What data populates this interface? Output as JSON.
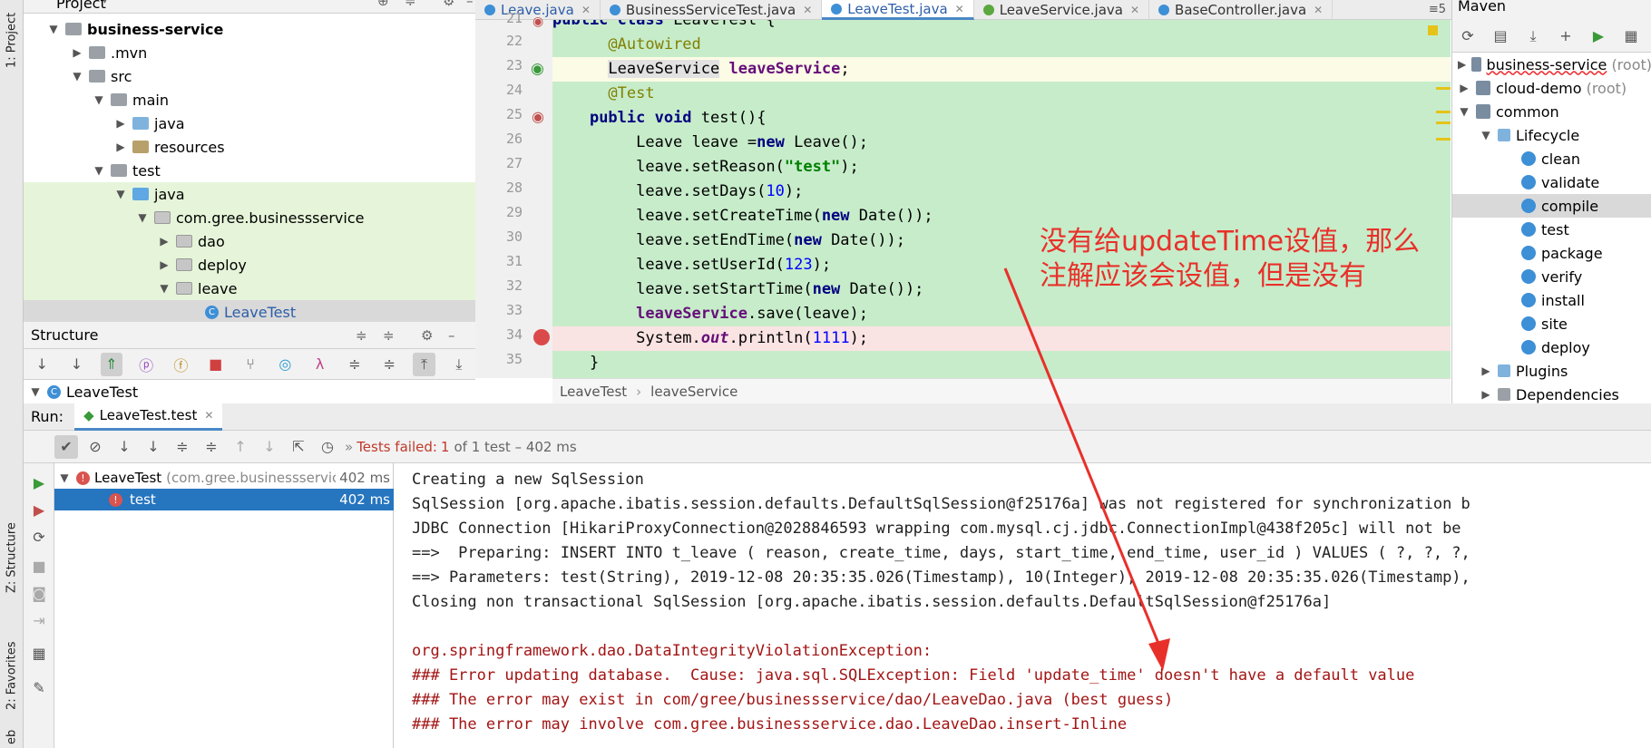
{
  "left_strip": {
    "project_tab": "1: Project",
    "structure_tab": "Z: Structure",
    "favorites_tab": "2: Favorites",
    "web_tab": "eb"
  },
  "project_panel": {
    "title": "Project",
    "tree": [
      {
        "label": "business-service",
        "bold": true
      },
      {
        "label": ".mvn"
      },
      {
        "label": "src"
      },
      {
        "label": "main"
      },
      {
        "label": "java"
      },
      {
        "label": "resources"
      },
      {
        "label": "test"
      },
      {
        "label": "java"
      },
      {
        "label": "com.gree.businessservice"
      },
      {
        "label": "dao"
      },
      {
        "label": "deploy"
      },
      {
        "label": "leave"
      },
      {
        "label": "LeaveTest"
      }
    ]
  },
  "structure_panel": {
    "title": "Structure",
    "root": "LeaveTest"
  },
  "editor": {
    "tabs": [
      {
        "label": "Leave.java",
        "active": false
      },
      {
        "label": "BusinessServiceTest.java",
        "active": false
      },
      {
        "label": "LeaveTest.java",
        "active": true
      },
      {
        "label": "LeaveService.java",
        "active": false
      },
      {
        "label": "BaseController.java",
        "active": false
      }
    ],
    "tab_overflow": "5",
    "line_numbers": [
      "21",
      "22",
      "23",
      "24",
      "25",
      "26",
      "27",
      "28",
      "29",
      "30",
      "31",
      "32",
      "33",
      "34",
      "35"
    ],
    "breadcrumb": [
      "LeaveTest",
      "leaveService"
    ]
  },
  "maven": {
    "title": "Maven",
    "items": [
      {
        "label": "business-service",
        "suffix": "(root)"
      },
      {
        "label": "cloud-demo",
        "suffix": "(root)"
      },
      {
        "label": "common",
        "suffix": ""
      },
      {
        "label": "Lifecycle",
        "suffix": ""
      },
      {
        "label": "clean",
        "suffix": ""
      },
      {
        "label": "validate",
        "suffix": ""
      },
      {
        "label": "compile",
        "suffix": ""
      },
      {
        "label": "test",
        "suffix": ""
      },
      {
        "label": "package",
        "suffix": ""
      },
      {
        "label": "verify",
        "suffix": ""
      },
      {
        "label": "install",
        "suffix": ""
      },
      {
        "label": "site",
        "suffix": ""
      },
      {
        "label": "deploy",
        "suffix": ""
      },
      {
        "label": "Plugins",
        "suffix": ""
      },
      {
        "label": "Dependencies",
        "suffix": ""
      }
    ]
  },
  "run": {
    "label": "Run:",
    "tab": "LeaveTest.test",
    "status_prefix": "Tests failed:",
    "status_count": "1",
    "status_suffix": "of 1 test – 402 ms",
    "tests": [
      {
        "name": "LeaveTest",
        "pkg": "(com.gree.businessservice",
        "time": "402 ms"
      },
      {
        "name": "test",
        "pkg": "",
        "time": "402 ms"
      }
    ],
    "console": [
      {
        "text": "Creating a new SqlSession",
        "err": false
      },
      {
        "text": "SqlSession [org.apache.ibatis.session.defaults.DefaultSqlSession@f25176a] was not registered for synchronization b",
        "err": false
      },
      {
        "text": "JDBC Connection [HikariProxyConnection@2028846593 wrapping com.mysql.cj.jdbc.ConnectionImpl@438f205c] will not be",
        "err": false
      },
      {
        "text": "==>  Preparing: INSERT INTO t_leave ( reason, create_time, days, start_time, end_time, user_id ) VALUES ( ?, ?, ?,",
        "err": false
      },
      {
        "text": "==> Parameters: test(String), 2019-12-08 20:35:35.026(Timestamp), 10(Integer), 2019-12-08 20:35:35.026(Timestamp),",
        "err": false
      },
      {
        "text": "Closing non transactional SqlSession [org.apache.ibatis.session.defaults.DefaultSqlSession@f25176a]",
        "err": false
      },
      {
        "text": "",
        "err": false
      },
      {
        "text": "org.springframework.dao.DataIntegrityViolationException:",
        "err": true
      },
      {
        "text": "### Error updating database.  Cause: java.sql.SQLException: Field 'update_time' doesn't have a default value",
        "err": true
      },
      {
        "text": "### The error may exist in com/gree/businessservice/dao/LeaveDao.java (best guess)",
        "err": true
      },
      {
        "text": "### The error may involve com.gree.businessservice.dao.LeaveDao.insert-Inline",
        "err": true
      }
    ]
  },
  "annotation": {
    "line1": "没有给updateTime设值，那么",
    "line2": "注解应该会设值，但是没有",
    "color": "#e8302a"
  },
  "colors": {
    "code_bg": "#c7ecca",
    "breakpoint_line": "#fae3e3",
    "error_text": "#a31515",
    "selection": "#2675bf"
  }
}
